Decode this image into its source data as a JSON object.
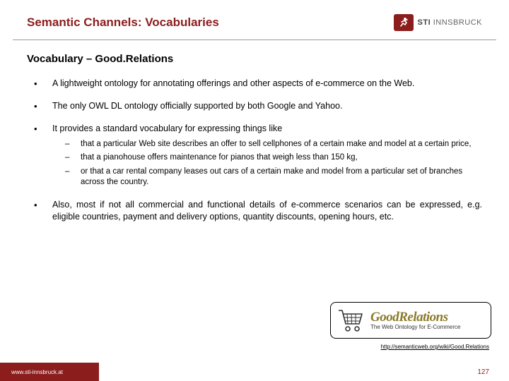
{
  "header": {
    "title": "Semantic Channels: Vocabularies",
    "logo_sti": "STI",
    "logo_loc": "INNSBRUCK"
  },
  "subtitle": "Vocabulary – Good.Relations",
  "bullets": {
    "b1": "A lightweight ontology for annotating offerings and other aspects of e-commerce on the Web.",
    "b2": "The only OWL DL ontology officially supported by both Google and Yahoo.",
    "b3": "It provides a standard vocabulary for expressing things like",
    "b3_sub": {
      "s1": "that a particular Web site describes an offer to sell cellphones of a certain make and model at a certain price,",
      "s2": "that a pianohouse offers maintenance for pianos that weigh less than 150 kg,",
      "s3": "or that a car rental company leases out cars of a certain make and model from a particular set of branches across the country."
    },
    "b4": "Also, most if not all commercial and functional details of e-commerce scenarios can be expressed, e.g. eligible countries, payment and delivery options, quantity discounts, opening hours, etc."
  },
  "gr": {
    "title": "GoodRelations",
    "tagline": "The Web Ontology for E-Commerce"
  },
  "source_link": "http://semanticweb.org/wiki/Good.Relations",
  "footer": {
    "url": "www.sti-innsbruck.at",
    "page": "127"
  }
}
